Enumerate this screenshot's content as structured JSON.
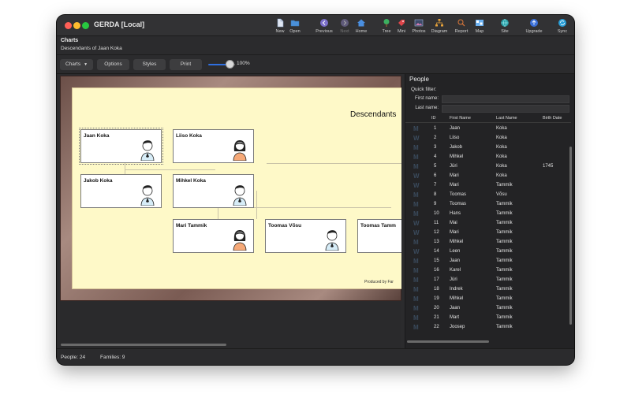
{
  "window": {
    "title": "GERDA [Local]"
  },
  "toolbar": {
    "new": "New",
    "open": "Open",
    "previous": "Previous",
    "next": "Next",
    "home": "Home",
    "tree": "Tree",
    "mini": "Mini",
    "photos": "Photos",
    "diagram": "Diagram",
    "report": "Report",
    "map": "Map",
    "site": "Site",
    "upgrade": "Upgrade",
    "sync": "Sync"
  },
  "header": {
    "title": "Charts",
    "subtitle": "Descendants of Jaan Koka"
  },
  "chart_toolbar": {
    "charts": "Charts",
    "options": "Options",
    "styles": "Styles",
    "print": "Print",
    "zoom": "100%",
    "zoom_level": 1.0
  },
  "chart": {
    "heading": "Descendants",
    "produced": "Produced by Far",
    "cards": {
      "c1": "Jaan Koka",
      "c2": "Liiso Koka",
      "c3": "Jakob Koka",
      "c4": "Mihkel Koka",
      "c5": "Mari Tammik",
      "c6": "Toomas Võsu",
      "c7": "Toomas Tamm"
    }
  },
  "people": {
    "title": "People",
    "quick_filter": "Quick filter:",
    "first_name_label": "First name:",
    "last_name_label": "Last name:",
    "first_name_value": "",
    "last_name_value": "",
    "columns": {
      "id": "ID",
      "first": "First Name",
      "last": "Last Name",
      "birth": "Birth Date"
    },
    "rows": [
      {
        "sex": "M",
        "id": "1",
        "first": "Jaan",
        "last": "Koka",
        "birth": ""
      },
      {
        "sex": "W",
        "id": "2",
        "first": "Liiso",
        "last": "Koka",
        "birth": ""
      },
      {
        "sex": "M",
        "id": "3",
        "first": "Jakob",
        "last": "Koka",
        "birth": ""
      },
      {
        "sex": "M",
        "id": "4",
        "first": "Mihkel",
        "last": "Koka",
        "birth": ""
      },
      {
        "sex": "M",
        "id": "5",
        "first": "Jüri",
        "last": "Koka",
        "birth": "1745"
      },
      {
        "sex": "W",
        "id": "6",
        "first": "Mari",
        "last": "Koka",
        "birth": ""
      },
      {
        "sex": "W",
        "id": "7",
        "first": "Mari",
        "last": "Tammik",
        "birth": ""
      },
      {
        "sex": "M",
        "id": "8",
        "first": "Toomas",
        "last": "Võsu",
        "birth": ""
      },
      {
        "sex": "M",
        "id": "9",
        "first": "Toomas",
        "last": "Tammik",
        "birth": ""
      },
      {
        "sex": "M",
        "id": "10",
        "first": "Hans",
        "last": "Tammik",
        "birth": ""
      },
      {
        "sex": "W",
        "id": "11",
        "first": "Mai",
        "last": "Tammik",
        "birth": ""
      },
      {
        "sex": "W",
        "id": "12",
        "first": "Mari",
        "last": "Tammik",
        "birth": ""
      },
      {
        "sex": "M",
        "id": "13",
        "first": "Mihkel",
        "last": "Tammik",
        "birth": ""
      },
      {
        "sex": "W",
        "id": "14",
        "first": "Leen",
        "last": "Tammik",
        "birth": ""
      },
      {
        "sex": "M",
        "id": "15",
        "first": "Jaan",
        "last": "Tammik",
        "birth": ""
      },
      {
        "sex": "M",
        "id": "16",
        "first": "Karel",
        "last": "Tammik",
        "birth": ""
      },
      {
        "sex": "M",
        "id": "17",
        "first": "Jüri",
        "last": "Tammik",
        "birth": ""
      },
      {
        "sex": "M",
        "id": "18",
        "first": "Indrek",
        "last": "Tammik",
        "birth": ""
      },
      {
        "sex": "M",
        "id": "19",
        "first": "Mihkel",
        "last": "Tammik",
        "birth": ""
      },
      {
        "sex": "M",
        "id": "20",
        "first": "Jaan",
        "last": "Tammik",
        "birth": ""
      },
      {
        "sex": "M",
        "id": "21",
        "first": "Mart",
        "last": "Tammik",
        "birth": ""
      },
      {
        "sex": "M",
        "id": "22",
        "first": "Joosep",
        "last": "Tammik",
        "birth": ""
      }
    ]
  },
  "status": {
    "people": "People: 24",
    "families": "Families: 9"
  },
  "colors": {
    "accent": "#2f6fe0",
    "chart_bg": "#fef9c8",
    "frame": "#a88a80"
  }
}
